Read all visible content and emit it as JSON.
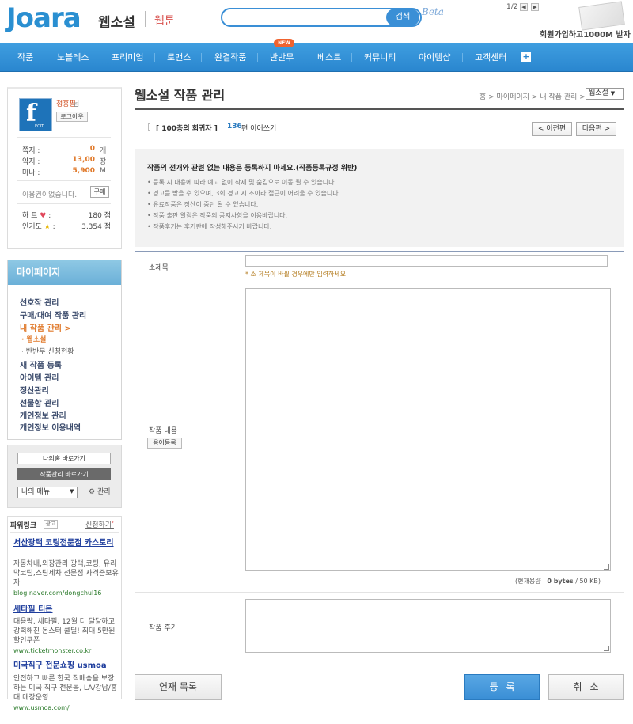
{
  "header": {
    "logo": "Joara",
    "brand_main": "웹소설",
    "brand_sub": "웹툰",
    "search_button": "검색",
    "beta": "Beta",
    "pager": "1/2",
    "promo_text": "회원가입하고1000M 받자"
  },
  "nav": {
    "items": [
      "작품",
      "노블레스",
      "프리미엄",
      "로맨스",
      "완결작품",
      "반반무",
      "베스트",
      "커뮤니티",
      "아이템샵",
      "고객센터"
    ],
    "new_badge": "NEW"
  },
  "profile": {
    "avatar_letter": "f",
    "avatar_tag": "ECIT",
    "user_name": "정흥필",
    "user_suffix": "님",
    "logout": "로그아웃",
    "stats": [
      {
        "label": "쪽지 :",
        "value": "0",
        "unit": "개"
      },
      {
        "label": "약지 :",
        "value": "13,00",
        "unit": "장"
      },
      {
        "label": "마나 :",
        "value": "5,900",
        "unit": "M"
      }
    ],
    "not_in_use": "이용권이없습니다.",
    "buy": "구매",
    "heart_label": "하  트",
    "heart_value": "180 점",
    "pop_label": "인기도",
    "pop_value": "3,354 점"
  },
  "mypage": {
    "title": "마이페이지",
    "items": [
      {
        "label": "선호작 관리"
      },
      {
        "label": "구매/대여 작품 관리"
      },
      {
        "label": "내 작품 관리  >"
      }
    ],
    "sub_items": [
      "· 웹소설",
      "· 반반무 신청현황"
    ],
    "more_items": [
      "새 작품 등록",
      "아이템 관리",
      "정산관리",
      "선물함 관리",
      "개인정보 관리",
      "개인정보 이용내역"
    ]
  },
  "shortcuts": {
    "my_work": "나의홈 바로가기",
    "manage": "작품관리 바로가기",
    "my_menu": "나의 메뉴",
    "manage_link": "관리"
  },
  "power_link": {
    "title": "파워링크",
    "ad_tag": "광고",
    "apply": "신청하기",
    "ads": [
      {
        "title": "서산광택 코팅전문점 카스토리",
        "desc": "자동차내,외장관리 광택,코팅, 유리막코팅,스팀세차 전문점 자격증보유자",
        "url": "blog.naver.com/dongchul16"
      },
      {
        "title": "세타필 티몬",
        "desc": "대용량. 세타필, 12월 더 달달하고 강력해진 몬스터 쿨딜! 최대 5만원 할인쿠폰",
        "url": "www.ticketmonster.co.kr"
      },
      {
        "title": "미국직구 전문쇼핑 usmoa",
        "desc": "안전하고 빠른 한국 직배송을 보장하는 미국 직구 전문몰, LA/강남/홍대 매장운영",
        "url": "www.usmoa.com/"
      }
    ]
  },
  "main": {
    "page_title": "웹소설 작품 관리",
    "breadcrumbs": "홈 > 마이페이지 > 내 작품 관리 >",
    "crumb_select": "웹소설",
    "work_name": "[ 100층의 회귀자 ]",
    "work_count": "136",
    "work_unit": "편 이어쓰기",
    "prev": "< 이전편",
    "next": "다음편 >",
    "notice_title": "작품의 전개와 관련 없는 내용은 등록하지 마세요.(작품등록규정 위반)",
    "notice_items": [
      "• 등록 시 내용에 따라 예고 없이 삭제 및 숨김으로 이동 될 수 있습니다.",
      "• 경고를 받을 수 있으며, 3회 경고 시 조아라 접근이 어려울 수 있습니다.",
      "• 유료작품은 정산이 중단 될 수 있습니다.",
      "• 작품 출판 알림은 작품의 공지사항을 이용바랍니다.",
      "• 작품후기는 후기란에 작성해주시기 바랍니다."
    ],
    "subtitle_label": "소제목",
    "subtitle_value": "",
    "subtitle_hint": "* 소 제목이 바뀔 경우에만 입력하세요",
    "content_label": "작품 내용",
    "term_button": "용어등록",
    "content_value": "",
    "capacity_prefix": "(현재용량 : ",
    "capacity_value": "0 bytes",
    "capacity_suffix": " / 50 KB)",
    "review_label": "작품 후기",
    "review_value": "",
    "btn_list": "연재 목록",
    "btn_submit": "등록",
    "btn_cancel": "취소"
  }
}
